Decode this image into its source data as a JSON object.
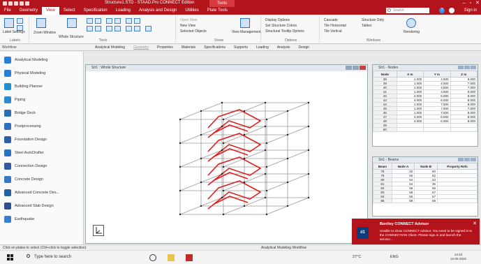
{
  "app": {
    "title": "Structure1.STD - STAAD.Pro CONNECT Edition",
    "tools_tab": "Tools",
    "brand_color": "#b3141b"
  },
  "menu": {
    "tabs": [
      "File",
      "Geometry",
      "View",
      "Select",
      "Specification",
      "Loading",
      "Analysis and Design",
      "Utilities",
      "Plate Tools"
    ],
    "active": "View",
    "search_placeholder": "Search",
    "signin": "Sign in"
  },
  "ribbon": {
    "label_settings": "Label Settings",
    "zoom_window": "Zoom Window",
    "display_whole": "Whole Structure",
    "open_view": "Open View",
    "new_view": "New View",
    "selected_objects": "Selected Objects",
    "view_management": "View Management",
    "display_options": "Display Options",
    "set_structure_colors": "Set Structure Colors",
    "structural_tooltip": "Structural Tooltip Options",
    "cascade": "Cascade",
    "tile_horizontal": "Tile Horizontal",
    "tile_vertical": "Tile Vertical",
    "structure_only": "Structure Only",
    "tables": "Tables",
    "rendering": "Rendering",
    "groups": [
      "Labels",
      "Tools",
      "Views",
      "Options",
      "Windows"
    ]
  },
  "workflow_bar": {
    "label": "Workflow",
    "tabs": [
      "Analytical Modeling",
      "Geometry",
      "Properties",
      "Materials",
      "Specifications",
      "Supports",
      "Loading",
      "Analysis",
      "Design"
    ],
    "active": "Geometry"
  },
  "sidebar": {
    "items": [
      {
        "label": "Analytical Modeling",
        "color": "#2a7fd4"
      },
      {
        "label": "Physical Modeling",
        "color": "#2a7fd4"
      },
      {
        "label": "Building Planner",
        "color": "#1f8fd1"
      },
      {
        "label": "Piping",
        "color": "#2b8ad0"
      },
      {
        "label": "Bridge Deck",
        "color": "#2c6fb3"
      },
      {
        "label": "Postprocessing",
        "color": "#3070c0"
      },
      {
        "label": "Foundation Design",
        "color": "#2d5fa8"
      },
      {
        "label": "Steel AutoDrafter",
        "color": "#2c72c4"
      },
      {
        "label": "Connection Design",
        "color": "#2f5b9e"
      },
      {
        "label": "Concrete Design",
        "color": "#3577c9"
      },
      {
        "label": "Advanced Concrete Des...",
        "color": "#285f9f"
      },
      {
        "label": "Advanced Slab Design",
        "color": "#2d4f8e"
      },
      {
        "label": "Earthquake",
        "color": "#3a7fcf"
      }
    ]
  },
  "canvas": {
    "title": "Str1 : Whole Structure"
  },
  "nodes_panel": {
    "title": "Str1 - Nodes",
    "columns": [
      "Node",
      "X m",
      "Y m",
      "Z m"
    ],
    "rows": [
      [
        "38",
        "1.000",
        "4.500",
        "8.000"
      ],
      [
        "39",
        "1.000",
        "4.500",
        "7.500"
      ],
      [
        "40",
        "1.000",
        "4.500",
        "7.000"
      ],
      [
        "41",
        "1.000",
        "4.500",
        "8.000"
      ],
      [
        "42",
        "4.000",
        "6.000",
        "8.000"
      ],
      [
        "43",
        "4.000",
        "6.000",
        "8.000"
      ],
      [
        "44",
        "1.000",
        "7.500",
        "8.000"
      ],
      [
        "45",
        "1.000",
        "7.500",
        "7.500"
      ],
      [
        "46",
        "1.000",
        "7.500",
        "8.000"
      ],
      [
        "47",
        "4.000",
        "6.000",
        "8.000"
      ],
      [
        "48",
        "4.000",
        "6.000",
        "8.000"
      ],
      [
        "49",
        "",
        "",
        ""
      ],
      [
        "50",
        "",
        "",
        ""
      ]
    ]
  },
  "beams_panel": {
    "title": "Str1 - Beams",
    "columns": [
      "Beam",
      "Node A",
      "Node B",
      "Property Refs"
    ],
    "rows": [
      [
        "78",
        "32",
        "50",
        ""
      ],
      [
        "79",
        "50",
        "52",
        ""
      ],
      [
        "80",
        "54",
        "34",
        ""
      ],
      [
        "81",
        "54",
        "36",
        ""
      ],
      [
        "82",
        "56",
        "56",
        ""
      ],
      [
        "83",
        "58",
        "57",
        ""
      ],
      [
        "84",
        "55",
        "57",
        ""
      ],
      [
        "85",
        "58",
        "59",
        ""
      ]
    ]
  },
  "toast": {
    "title": "Bentley CONNECT Advisor",
    "body": "Unable to show CONNECT Advisor. You need to be signed in to the CONNECTION Client. Please sign in and launch the service...",
    "icon_label": "ıl1"
  },
  "status": {
    "hint": "Click on plates to select (Ctrl+click to toggle selection)",
    "workflow": "Analytical Modeling Workflow"
  },
  "taskbar": {
    "search": "Type here to search",
    "temperature": "27°C",
    "language": "ENG",
    "time": "13:43",
    "date": "12-05-2022"
  }
}
